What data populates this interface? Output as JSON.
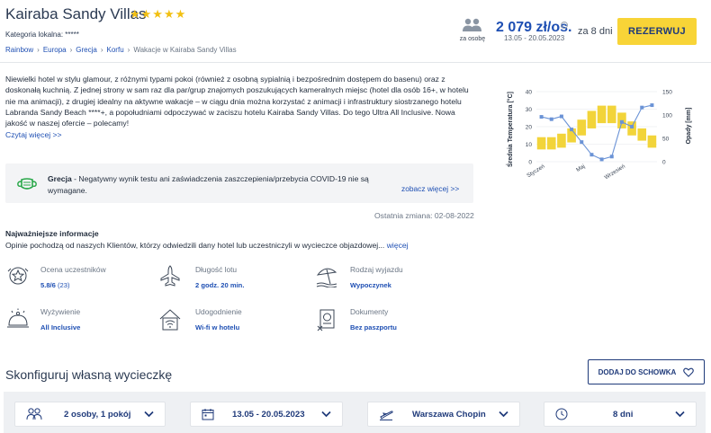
{
  "header": {
    "title": "Kairaba Sandy Villas",
    "stars": "★★★★★",
    "category": "Kategoria lokalna: *****",
    "breadcrumb": [
      "Rainbow",
      "Europa",
      "Grecja",
      "Korfu",
      "Wakacje w Kairaba Sandy Villas"
    ],
    "per_person_label": "za osobę",
    "price": "2 079 zł/os.",
    "price_info": "i",
    "dates": "13.05 - 20.05.2023",
    "duration": "za 8 dni",
    "reserve_label": "REZERWUJ"
  },
  "description": {
    "text": "Niewielki hotel w stylu glamour, z różnymi typami pokoi (również z osobną sypialnią i bezpośrednim dostępem do basenu) oraz z doskonałą kuchnią. Z jednej strony w sam raz dla par/grup znajomych poszukujących kameralnych miejsc (hotel dla osób 16+, w hotelu nie ma animacji), z drugiej idealny na aktywne wakacje – w ciągu dnia można korzystać z animacji i infrastruktury siostrzanego hotelu Labranda Sandy Beach ****+, a popołudniami odpoczywać w zaciszu hotelu Kairaba Sandy Villas. Do tego Ultra All Inclusive. Nowa jakość w naszej ofercie – polecamy!",
    "read_more": "Czytaj więcej >>"
  },
  "covid": {
    "country": "Grecja",
    "message": " - Negatywny wynik testu ani zaświadczenia zaszczepienia/przebycia COVID-19 nie są wymagane.",
    "link": "zobacz więcej >>",
    "last_change": "Ostatnia zmiana: 02-08-2022"
  },
  "info": {
    "heading": "Najważniejsze informacje",
    "subtitle": "Opinie pochodzą od naszych Klientów, którzy odwiedzili dany hotel lub uczestniczyli w wycieczce objazdowej...",
    "more_link": "więcej",
    "features": [
      {
        "label": "Ocena uczestników",
        "value": "5.8/6",
        "extra": " (23)",
        "icon": "star-badge-icon"
      },
      {
        "label": "Długość lotu",
        "value": "2 godz. 20 min.",
        "icon": "airplane-icon"
      },
      {
        "label": "Rodzaj wyjazdu",
        "value": "Wypoczynek",
        "icon": "beach-umbrella-icon"
      },
      {
        "label": "Wyżywienie",
        "value": "All Inclusive",
        "icon": "food-cloche-icon"
      },
      {
        "label": "Udogodnienie",
        "value": "Wi-fi w hotelu",
        "icon": "wifi-house-icon"
      },
      {
        "label": "Dokumenty",
        "value": "Bez paszportu",
        "icon": "passport-document-icon"
      }
    ]
  },
  "configure": {
    "title": "Skonfiguruj własną wycieczkę",
    "add_label": "DODAJ DO SCHOWKA",
    "selectors": [
      {
        "value": "2 osoby, 1 pokój",
        "icon": "people-icon"
      },
      {
        "value": "13.05 - 20.05.2023",
        "icon": "calendar-icon"
      },
      {
        "value": "Warszawa Chopin",
        "icon": "plane-departure-icon"
      },
      {
        "value": "8 dni",
        "icon": "clock-icon"
      }
    ]
  },
  "chart_data": {
    "type": "bar+line",
    "y_left_label": "Średnia Temperatura [°C]",
    "y_right_label": "Opady [mm]",
    "y_left_ticks": [
      "40",
      "30",
      "20",
      "10",
      "0"
    ],
    "y_right_ticks": [
      "150",
      "100",
      "50",
      "0"
    ],
    "ylim_left": [
      0,
      40
    ],
    "ylim_right": [
      0,
      150
    ],
    "x_labels": [
      "Styczeń",
      "Maj",
      "Wrzesień"
    ],
    "temperature": [
      {
        "min": 7,
        "max": 14
      },
      {
        "min": 7,
        "max": 14
      },
      {
        "min": 8,
        "max": 16
      },
      {
        "min": 11,
        "max": 19
      },
      {
        "min": 15,
        "max": 24
      },
      {
        "min": 19,
        "max": 29
      },
      {
        "min": 22,
        "max": 32
      },
      {
        "min": 22,
        "max": 32
      },
      {
        "min": 19,
        "max": 28
      },
      {
        "min": 15,
        "max": 23
      },
      {
        "min": 12,
        "max": 19
      },
      {
        "min": 8,
        "max": 15
      }
    ],
    "precipitation": [
      96,
      91,
      97,
      69,
      42,
      15,
      5,
      11,
      85,
      75,
      116,
      121
    ],
    "colors": {
      "bars": "#f2d43a",
      "line": "#6b93d6"
    }
  }
}
